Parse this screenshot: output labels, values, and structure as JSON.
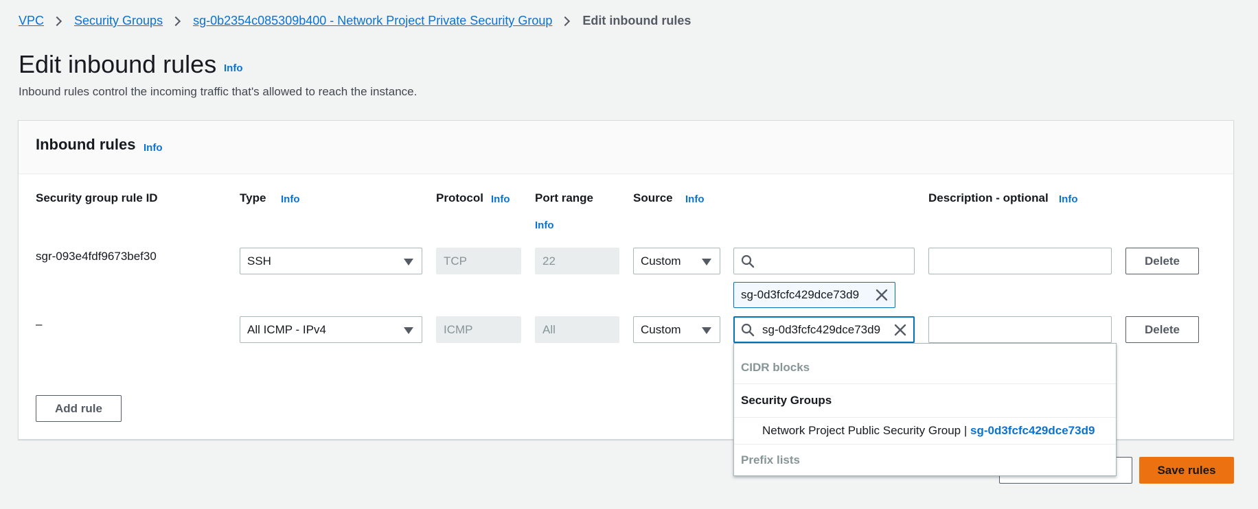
{
  "breadcrumb": {
    "items": [
      "VPC",
      "Security Groups",
      "sg-0b2354c085309b400 - Network Project Private Security Group"
    ],
    "current": "Edit inbound rules"
  },
  "page": {
    "title": "Edit inbound rules",
    "info": "Info",
    "description": "Inbound rules control the incoming traffic that's allowed to reach the instance."
  },
  "panel": {
    "title": "Inbound rules",
    "info": "Info",
    "columns": {
      "rule_id": "Security group rule ID",
      "type": "Type",
      "protocol": "Protocol",
      "port_range": "Port range",
      "source": "Source",
      "description": "Description - optional"
    },
    "info_label": "Info"
  },
  "rules": [
    {
      "id": "sgr-093e4fdf9673bef30",
      "type": "SSH",
      "protocol": "TCP",
      "port_range": "22",
      "source": "Custom",
      "search_value": "",
      "token": "sg-0d3fcfc429dce73d9",
      "description": "",
      "delete_label": "Delete"
    },
    {
      "id": "–",
      "type": "All ICMP - IPv4",
      "protocol": "ICMP",
      "port_range": "All",
      "source": "Custom",
      "search_value": "sg-0d3fcfc429dce73d9",
      "description": "",
      "delete_label": "Delete"
    }
  ],
  "add_rule_label": "Add rule",
  "dropdown": {
    "cidr_label": "CIDR blocks",
    "sg_label": "Security Groups",
    "option_name": "Network Project Public Security Group |",
    "option_id": "sg-0d3fcfc429dce73d9",
    "prefix_label": "Prefix lists"
  },
  "footer": {
    "save_label": "Save rules"
  },
  "colors": {
    "link": "#0972d3",
    "primary_button": "#ec7211",
    "focus_border": "#0073bb",
    "background": "#f2f3f3"
  }
}
